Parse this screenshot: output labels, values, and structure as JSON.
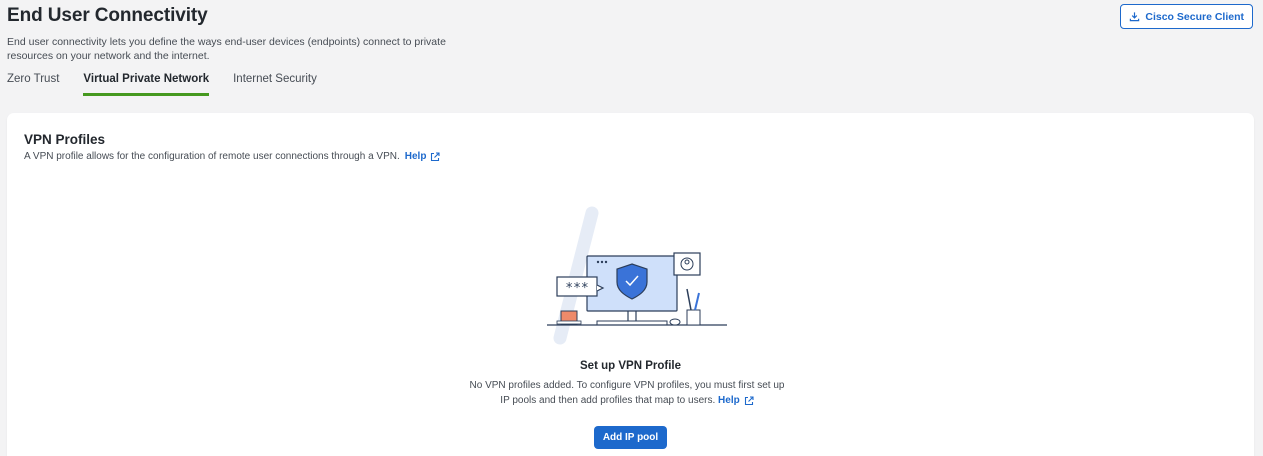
{
  "header": {
    "title": "End User Connectivity",
    "description": "End user connectivity lets you define the ways end-user devices (endpoints) connect to private resources on your network and the internet.",
    "cta_label": "Cisco Secure Client",
    "cta_icon": "download-icon"
  },
  "tabs": [
    {
      "label": "Zero Trust",
      "active": false
    },
    {
      "label": "Virtual Private Network",
      "active": true
    },
    {
      "label": "Internet Security",
      "active": false
    }
  ],
  "card": {
    "title": "VPN Profiles",
    "description": "A VPN profile allows for the configuration of remote user connections through a VPN.",
    "help_label": "Help"
  },
  "empty_state": {
    "title": "Set up VPN Profile",
    "description": "No VPN profiles added. To configure VPN profiles, you must first set up IP pools and then add profiles that map to users.",
    "help_label": "Help",
    "button_label": "Add IP pool",
    "illustration_text": "***"
  },
  "colors": {
    "accent": "#1d69cc",
    "tab_active": "#45991f",
    "background": "#f3f3f4"
  }
}
